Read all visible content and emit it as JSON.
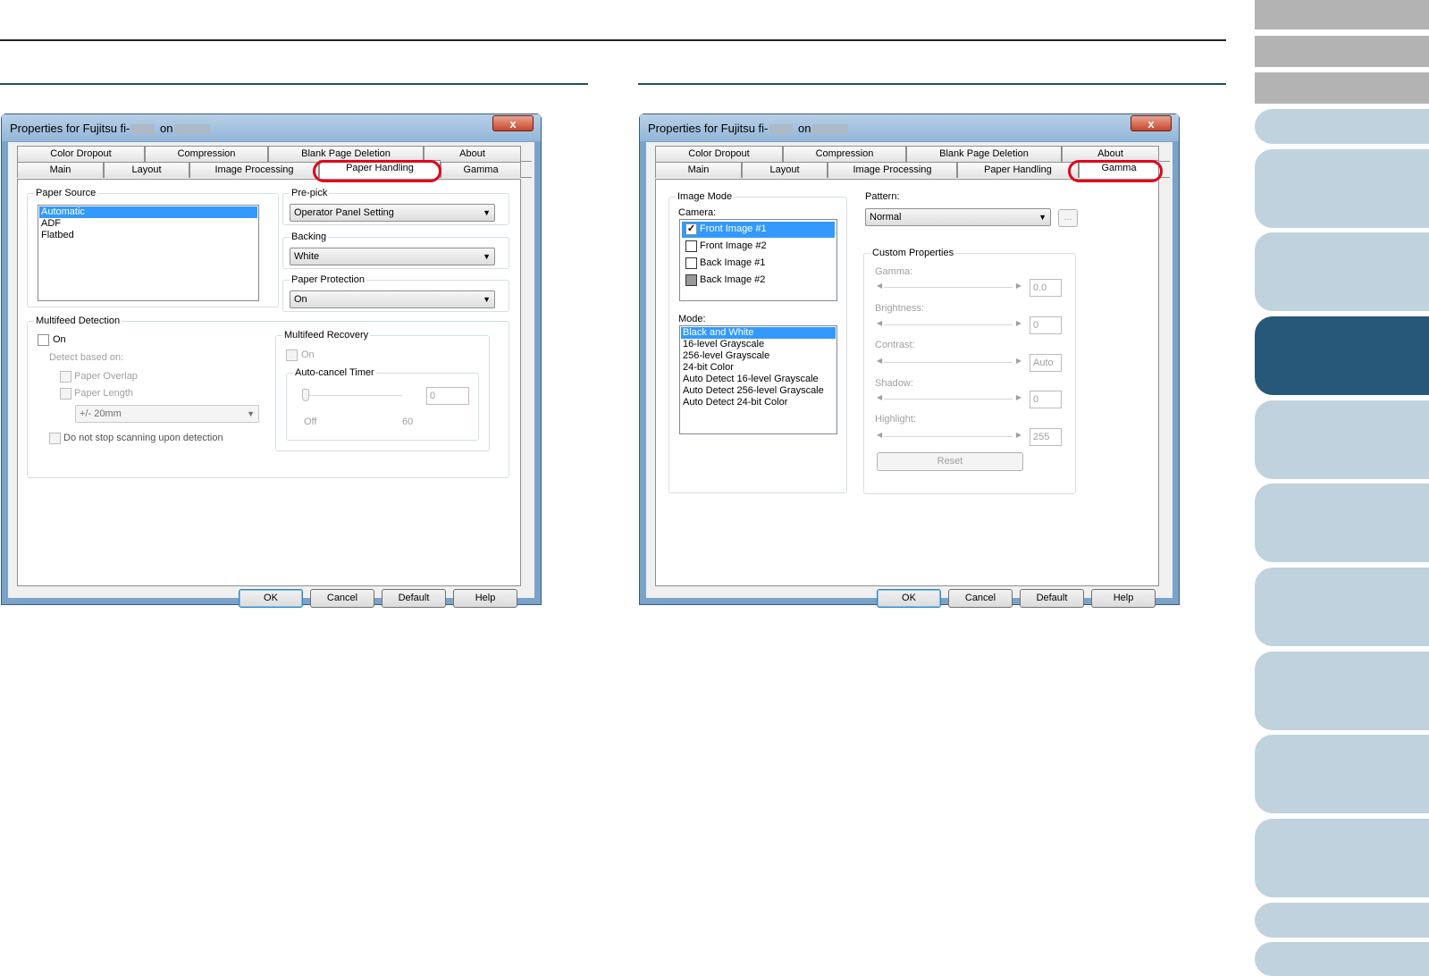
{
  "sidebar_tab_count": 14,
  "colors": {
    "section_line": "#254e6e",
    "active_tab": "#27587a",
    "inactive_tab": "#c0d2de",
    "grey_tab": "#b3b3b3",
    "highlight": "#e2001a"
  },
  "left_window": {
    "title_prefix": "Properties for Fujitsu fi-",
    "title_on": "on",
    "close_label": "x",
    "tabs_top": [
      "Color Dropout",
      "Compression",
      "Blank Page Deletion",
      "About"
    ],
    "tabs_bottom": [
      "Main",
      "Layout",
      "Image Processing",
      "Paper Handling",
      "Gamma"
    ],
    "paper_source": {
      "label": "Paper Source",
      "items": [
        "Automatic",
        "ADF",
        "Flatbed"
      ]
    },
    "prepick": {
      "label": "Pre-pick",
      "value": "Operator Panel Setting"
    },
    "backing": {
      "label": "Backing",
      "value": "White"
    },
    "paper_protection": {
      "label": "Paper Protection",
      "value": "On"
    },
    "multifeed": {
      "label": "Multifeed Detection",
      "on": "On",
      "detect_based_on": "Detect based on:",
      "paper_overlap": "Paper Overlap",
      "paper_length": "Paper Length",
      "length_value": "+/- 20mm",
      "do_not_stop": "Do not stop scanning upon detection"
    },
    "recovery": {
      "label": "Multifeed Recovery",
      "on": "On",
      "timer_label": "Auto-cancel Timer",
      "timer_value": "0",
      "min": "Off",
      "max": "60"
    },
    "buttons": {
      "ok": "OK",
      "cancel": "Cancel",
      "default": "Default",
      "help": "Help"
    }
  },
  "right_window": {
    "title_prefix": "Properties for Fujitsu fi-",
    "title_on": "on",
    "close_label": "x",
    "tabs_top": [
      "Color Dropout",
      "Compression",
      "Blank Page Deletion",
      "About"
    ],
    "tabs_bottom": [
      "Main",
      "Layout",
      "Image Processing",
      "Paper Handling",
      "Gamma"
    ],
    "image_mode": {
      "label": "Image Mode",
      "camera_label": "Camera:",
      "cameras": [
        "Front Image #1",
        "Front Image #2",
        "Back Image #1",
        "Back Image #2"
      ],
      "mode_label": "Mode:",
      "modes": [
        "Black and White",
        "16-level Grayscale",
        "256-level Grayscale",
        "24-bit Color",
        "Auto Detect 16-level Grayscale",
        "Auto Detect 256-level Grayscale",
        "Auto Detect 24-bit Color"
      ]
    },
    "pattern": {
      "label": "Pattern:",
      "value": "Normal",
      "browse": "..."
    },
    "custom": {
      "label": "Custom Properties",
      "gamma": {
        "label": "Gamma:",
        "value": "0.0"
      },
      "brightness": {
        "label": "Brightness:",
        "value": "0"
      },
      "contrast": {
        "label": "Contrast:",
        "value": "Auto"
      },
      "shadow": {
        "label": "Shadow:",
        "value": "0"
      },
      "highlight": {
        "label": "Highlight:",
        "value": "255"
      },
      "reset": "Reset"
    },
    "buttons": {
      "ok": "OK",
      "cancel": "Cancel",
      "default": "Default",
      "help": "Help"
    }
  }
}
